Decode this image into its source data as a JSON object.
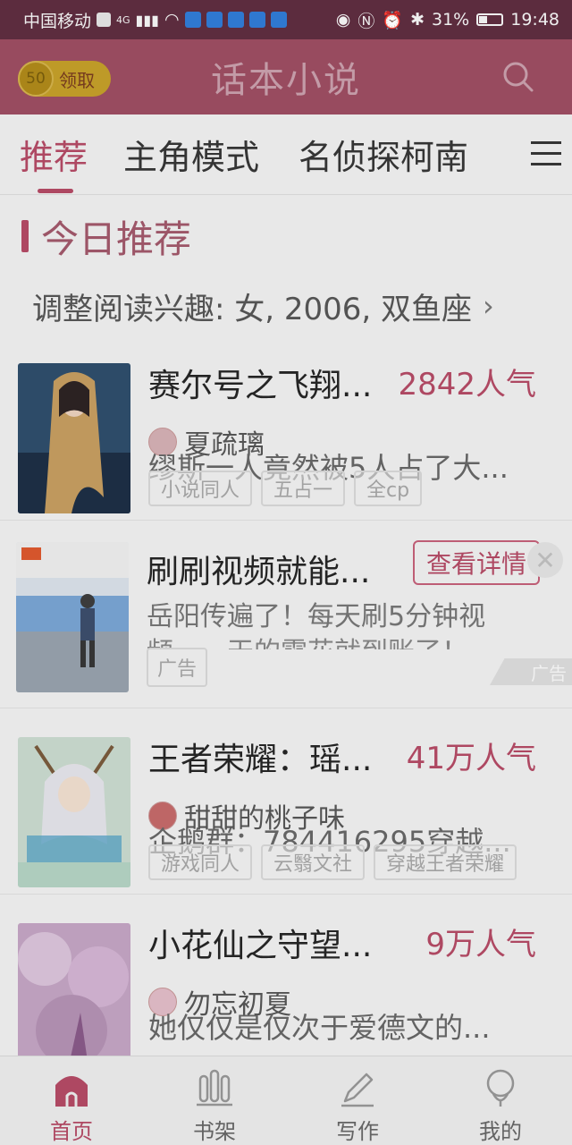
{
  "status_bar": {
    "carrier": "中国移动",
    "network": "4G",
    "battery": "31%",
    "time": "19:48"
  },
  "header": {
    "coin_value": "50",
    "coin_label": "领取",
    "title": "话本小说"
  },
  "tabs": [
    {
      "label": "推荐"
    },
    {
      "label": "主角模式"
    },
    {
      "label": "名侦探柯南"
    }
  ],
  "section": {
    "title": "今日推荐",
    "interest": "调整阅读兴趣: 女, 2006, 双鱼座"
  },
  "books": [
    {
      "title": "赛尔号之飞翔...",
      "popularity": "2842人气",
      "author": "夏疏璃",
      "description": "缪斯一人竟然被5人占了大...",
      "tags": [
        "小说同人",
        "五占一",
        "全cp"
      ]
    },
    {
      "title": "王者荣耀：瑶...",
      "popularity": "41万人气",
      "author": "甜甜的桃子味",
      "description": "企鹅群：784416295穿越...",
      "tags": [
        "游戏同人",
        "云翳文社",
        "穿越王者荣耀"
      ]
    },
    {
      "title": "小花仙之守望...",
      "popularity": "9万人气",
      "author": "勿忘初夏",
      "description": "她仅仅是仅次于爱德文的...",
      "tags": []
    }
  ],
  "ad": {
    "title": "刷刷视频就能...",
    "button": "查看详情",
    "desc_line1": "岳阳传遍了！每天刷5分钟视",
    "desc_line2": "频，一天的零花就到账了！",
    "tag": "广告",
    "mark": "广告"
  },
  "bottom_nav": [
    {
      "label": "首页",
      "icon": "home-icon"
    },
    {
      "label": "书架",
      "icon": "bookshelf-icon"
    },
    {
      "label": "写作",
      "icon": "pen-icon"
    },
    {
      "label": "我的",
      "icon": "profile-icon"
    }
  ],
  "colors": {
    "accent": "#b84965",
    "header_bg": "#a04c62",
    "coin": "#c9a227"
  }
}
